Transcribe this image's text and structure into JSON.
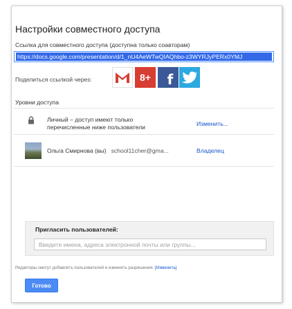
{
  "dialog": {
    "title": "Настройки совместного доступа",
    "link_label": "Ссылка для совместного доступа (доступна только соавторам)",
    "link_url": "https://docs.google.com/presentation/d/1_nU4AeWTwQIAQhbo-z3WYRJyPERx0YMJ",
    "share_via_label": "Поделиться ссылкой через:",
    "share_buttons": [
      {
        "icon": "gmail-icon",
        "glyph": "M"
      },
      {
        "icon": "google-plus-icon",
        "glyph": "8+"
      },
      {
        "icon": "facebook-icon",
        "glyph": "f"
      },
      {
        "icon": "twitter-icon",
        "glyph": ""
      }
    ],
    "access_section_label": "Уровни доступа",
    "access_rows": [
      {
        "icon": "lock-icon",
        "line1": "Личный – доступ имеют только",
        "line2": "перечисленные ниже пользователи",
        "action": "Изменить..."
      },
      {
        "icon": "avatar",
        "name": "Ольга Смирнова (вы)",
        "email": "school11cher@gma...",
        "role": "Владелец"
      }
    ],
    "invite": {
      "label": "Пригласить пользователей:",
      "placeholder": "Введите имена, адреса электронной почты или группы..."
    },
    "note": {
      "text": "Редакторы смогут добавлять пользователей и изменять разрешения.",
      "link": "[Изменить]"
    },
    "done_button": "Готово"
  },
  "colors": {
    "accent": "#4c8bf5",
    "link": "#1155cc",
    "gplus": "#d73d32",
    "facebook": "#3b5998",
    "twitter": "#2da9e1"
  }
}
